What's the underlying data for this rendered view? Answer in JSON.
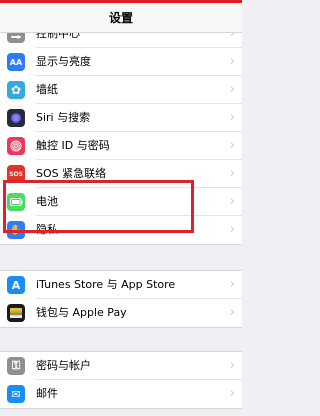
{
  "header": {
    "title": "设置"
  },
  "groups": [
    {
      "items": [
        {
          "label": "控制中心",
          "icon": "control-center-icon",
          "color": "#8e8e93"
        },
        {
          "label": "显示与亮度",
          "icon": "display-brightness-icon",
          "color": "#2f7cf6",
          "glyph": "AA"
        },
        {
          "label": "墙纸",
          "icon": "wallpaper-icon",
          "color": "#35aadc",
          "glyph": "✿"
        },
        {
          "label": "Siri 与搜索",
          "icon": "siri-icon",
          "color": "#2a2a3a",
          "glyph": "◉"
        },
        {
          "label": "触控 ID 与密码",
          "icon": "touch-id-icon",
          "color": "#f2355b",
          "glyph": "◎"
        },
        {
          "label": "SOS 紧急联络",
          "icon": "sos-icon",
          "color": "#e0332c",
          "glyph": "SOS"
        },
        {
          "label": "电池",
          "icon": "battery-icon",
          "color": "#4cd964"
        },
        {
          "label": "隐私",
          "icon": "privacy-hand-icon",
          "color": "#2f7cf6",
          "glyph": "✋"
        }
      ]
    },
    {
      "items": [
        {
          "label": "iTunes Store 与 App Store",
          "icon": "app-store-icon",
          "color": "#1a8df2",
          "glyph": "A"
        },
        {
          "label": "钱包与 Apple Pay",
          "icon": "wallet-icon",
          "color": "#1c1c1e"
        }
      ]
    },
    {
      "items": [
        {
          "label": "密码与帐户",
          "icon": "key-icon",
          "color": "#8e8e93",
          "glyph": "⚿"
        },
        {
          "label": "邮件",
          "icon": "mail-icon",
          "color": "#1a8df2",
          "glyph": "✉"
        }
      ]
    }
  ],
  "highlight_color": "#d9232d",
  "chevron": "›"
}
